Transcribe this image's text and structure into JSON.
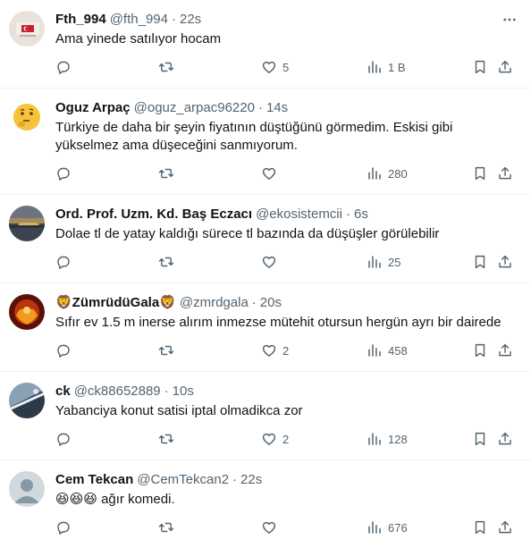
{
  "tweets": [
    {
      "name": "Fth_994",
      "handle": "@fth_994",
      "time": "22s",
      "text": "Ama yinede satılıyor hocam",
      "replies": "",
      "retweets": "",
      "likes": "5",
      "views": "1 B"
    },
    {
      "name": "Oguz Arpaç",
      "handle": "@oguz_arpac96220",
      "time": "14s",
      "text": "Türkiye de daha bir şeyin fiyatının düştüğünü görmedim. Eskisi gibi yükselmez ama düşeceğini sanmıyorum.",
      "replies": "",
      "retweets": "",
      "likes": "",
      "views": "280"
    },
    {
      "name": "Ord. Prof. Uzm. Kd. Baş Eczacı",
      "handle": "@ekosistemcii",
      "time": "6s",
      "text": "Dolae tl de yatay kaldığı sürece tl bazında da düşüşler görülebilir",
      "replies": "",
      "retweets": "",
      "likes": "",
      "views": "25"
    },
    {
      "name": "🦁ZümrüdüGala🦁",
      "handle": "@zmrdgala",
      "time": "20s",
      "text": "Sıfır ev 1.5 m inerse alırım inmezse mütehit otursun hergün ayrı bir dairede",
      "replies": "",
      "retweets": "",
      "likes": "2",
      "views": "458"
    },
    {
      "name": "ck",
      "handle": "@ck88652889",
      "time": "10s",
      "text": "Yabanciya konut satisi iptal olmadikca zor",
      "replies": "",
      "retweets": "",
      "likes": "2",
      "views": "128"
    },
    {
      "name": "Cem Tekcan",
      "handle": "@CemTekcan2",
      "time": "22s",
      "text": "😆😆😆 ağır komedi.",
      "replies": "",
      "retweets": "",
      "likes": "",
      "views": "676"
    }
  ],
  "dot": "·",
  "colors": {
    "text": "#0f1419",
    "muted": "#536471",
    "divider": "#eff3f4"
  },
  "icons": {
    "reply": "reply-icon",
    "retweet": "retweet-icon",
    "like": "heart-icon",
    "views": "views-icon",
    "bookmark": "bookmark-icon",
    "share": "share-icon",
    "more": "more-icon"
  }
}
